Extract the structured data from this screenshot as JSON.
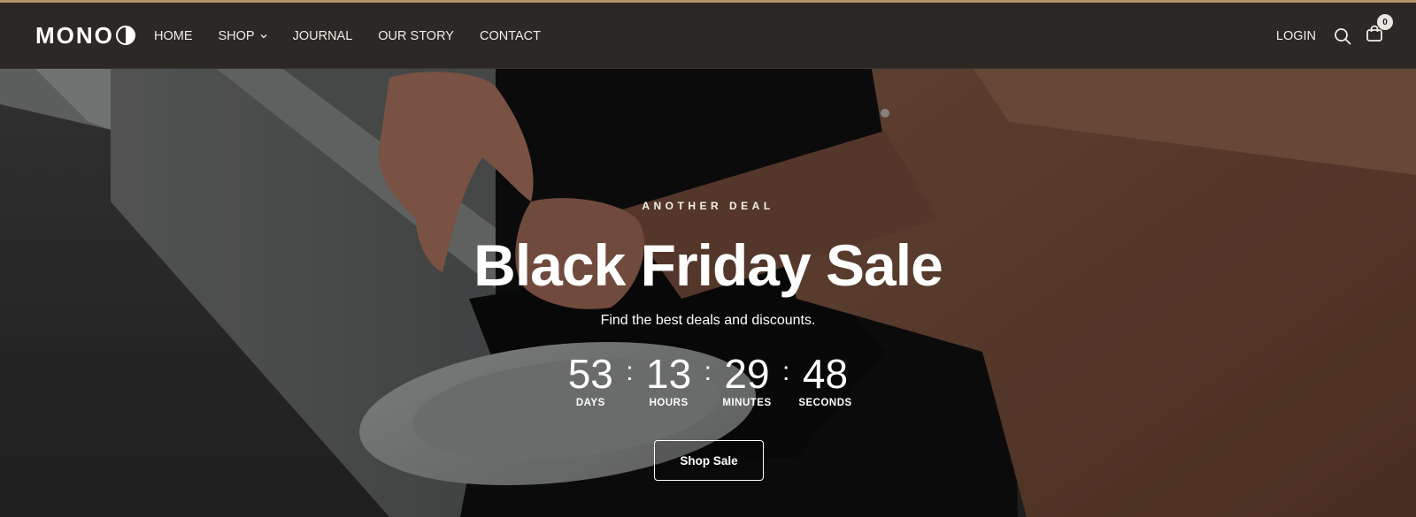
{
  "brand": {
    "logo_text": "MONO"
  },
  "nav": {
    "items": [
      {
        "label": "HOME"
      },
      {
        "label": "SHOP"
      },
      {
        "label": "JOURNAL"
      },
      {
        "label": "OUR STORY"
      },
      {
        "label": "CONTACT"
      }
    ]
  },
  "header": {
    "login_label": "LOGIN",
    "cart_count": "0"
  },
  "hero": {
    "eyebrow": "ANOTHER DEAL",
    "title": "Black Friday Sale",
    "subtitle": "Find the best deals and discounts.",
    "countdown": {
      "days": "53",
      "days_label": "DAYS",
      "hours": "13",
      "hours_label": "HOURS",
      "minutes": "29",
      "minutes_label": "MINUTES",
      "seconds": "48",
      "seconds_label": "SECONDS",
      "separator": ":"
    },
    "cta_label": "Shop Sale"
  },
  "colors": {
    "header_bg": "#2b2825",
    "top_accent": "#b5936a",
    "jacket": "#8a5d44"
  },
  "icons": [
    "search-icon",
    "cart-icon",
    "chevron-down-icon",
    "logo-half-circle-icon"
  ]
}
